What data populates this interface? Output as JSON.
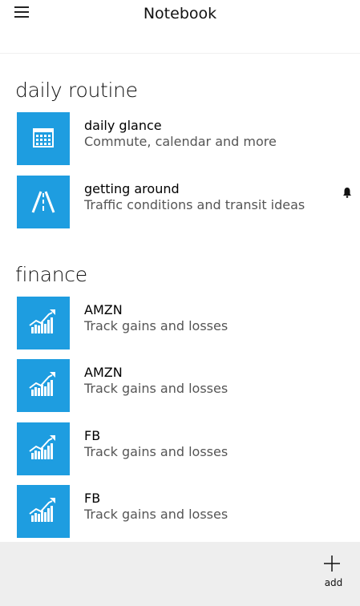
{
  "header": {
    "title": "Notebook"
  },
  "sections": [
    {
      "title": "daily routine",
      "items": [
        {
          "title": "daily glance",
          "subtitle": "Commute, calendar and more"
        },
        {
          "title": "getting around",
          "subtitle": "Traffic conditions and transit ideas"
        }
      ]
    },
    {
      "title": "finance",
      "items": [
        {
          "title": "AMZN",
          "subtitle": "Track gains and losses"
        },
        {
          "title": "AMZN",
          "subtitle": "Track gains and losses"
        },
        {
          "title": "FB",
          "subtitle": "Track gains and losses"
        },
        {
          "title": "FB",
          "subtitle": "Track gains and losses"
        }
      ]
    }
  ],
  "appbar": {
    "add_label": "add"
  },
  "colors": {
    "tile": "#1e9de0",
    "appbar": "#eeeeee"
  }
}
